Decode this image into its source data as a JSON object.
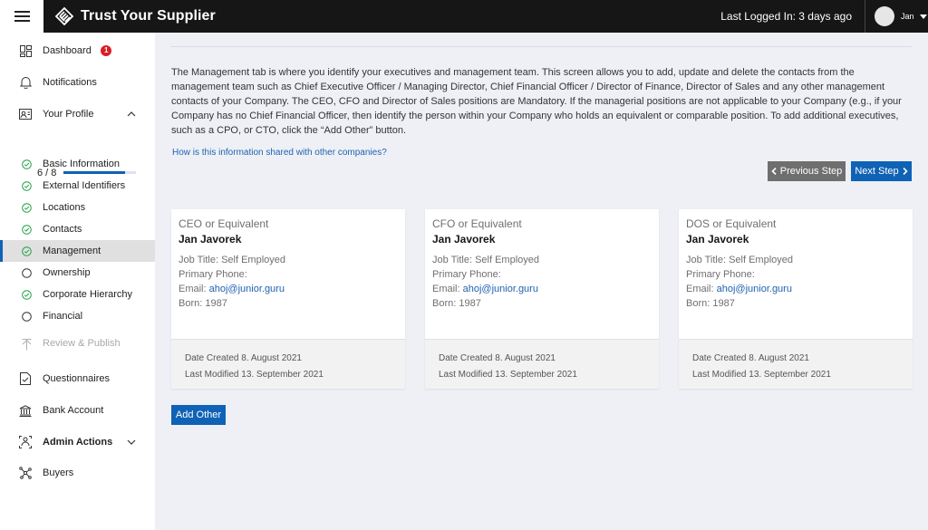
{
  "header": {
    "app_title": "Trust Your Supplier",
    "last_logged": "Last Logged In: 3 days ago",
    "user_name": "Jan"
  },
  "sidebar": {
    "dashboard": {
      "label": "Dashboard",
      "badge": "1"
    },
    "notifications": {
      "label": "Notifications"
    },
    "your_profile": {
      "label": "Your Profile",
      "progress_text": "6 / 8",
      "progress": 0.85
    },
    "profile_items": [
      {
        "label": "Basic Information",
        "status": "complete"
      },
      {
        "label": "External Identifiers",
        "status": "complete"
      },
      {
        "label": "Locations",
        "status": "complete"
      },
      {
        "label": "Contacts",
        "status": "complete"
      },
      {
        "label": "Management",
        "status": "complete",
        "active": true
      },
      {
        "label": "Ownership",
        "status": "incomplete"
      },
      {
        "label": "Corporate Hierarchy",
        "status": "complete"
      },
      {
        "label": "Financial",
        "status": "incomplete"
      },
      {
        "label": "Review & Publish",
        "status": "disabled"
      }
    ],
    "questionnaires": {
      "label": "Questionnaires"
    },
    "bank_account": {
      "label": "Bank Account"
    },
    "admin_actions": {
      "label": "Admin Actions"
    },
    "buyers": {
      "label": "Buyers"
    }
  },
  "main": {
    "intro": "The Management tab is where you identify your executives and management team. This screen allows you to add, update and delete the contacts from the management team such as Chief Executive Officer / Managing Director, Chief Financial Officer / Director of Finance, Director of Sales and any other management contacts of your Company. The CEO, CFO and Director of Sales positions are Mandatory. If the managerial positions are not applicable to your Company (e.g., if your Company has no Chief Financial Officer, then identify the person within your Company who holds an equivalent or comparable position. To add additional executives, such as a CPO, or CTO, click the “Add Other” button.",
    "share_link": "How is this information shared with other companies?",
    "prev_button": "Previous Step",
    "next_button": "Next Step",
    "add_button": "Add Other",
    "cards": [
      {
        "role": "CEO or Equivalent",
        "name": "Jan Javorek",
        "job_title": "Job Title: Self Employed",
        "phone_label": "Primary Phone:",
        "email_label": "Email:",
        "email": "ahoj@junior.guru",
        "born": "Born: 1987",
        "created": "Date Created 8. August 2021",
        "modified": "Last Modified 13. September 2021"
      },
      {
        "role": "CFO or Equivalent",
        "name": "Jan Javorek",
        "job_title": "Job Title: Self Employed",
        "phone_label": "Primary Phone:",
        "email_label": "Email:",
        "email": "ahoj@junior.guru",
        "born": "Born: 1987",
        "created": "Date Created 8. August 2021",
        "modified": "Last Modified 13. September 2021"
      },
      {
        "role": "DOS or Equivalent",
        "name": "Jan Javorek",
        "job_title": "Job Title: Self Employed",
        "phone_label": "Primary Phone:",
        "email_label": "Email:",
        "email": "ahoj@junior.guru",
        "born": "Born: 1987",
        "created": "Date Created 8. August 2021",
        "modified": "Last Modified 13. September 2021"
      }
    ]
  },
  "colors": {
    "topbar": "#161616",
    "accent": "#0f62b5",
    "complete": "#24a148",
    "badge": "#da1e28",
    "background": "#eef0f6"
  }
}
